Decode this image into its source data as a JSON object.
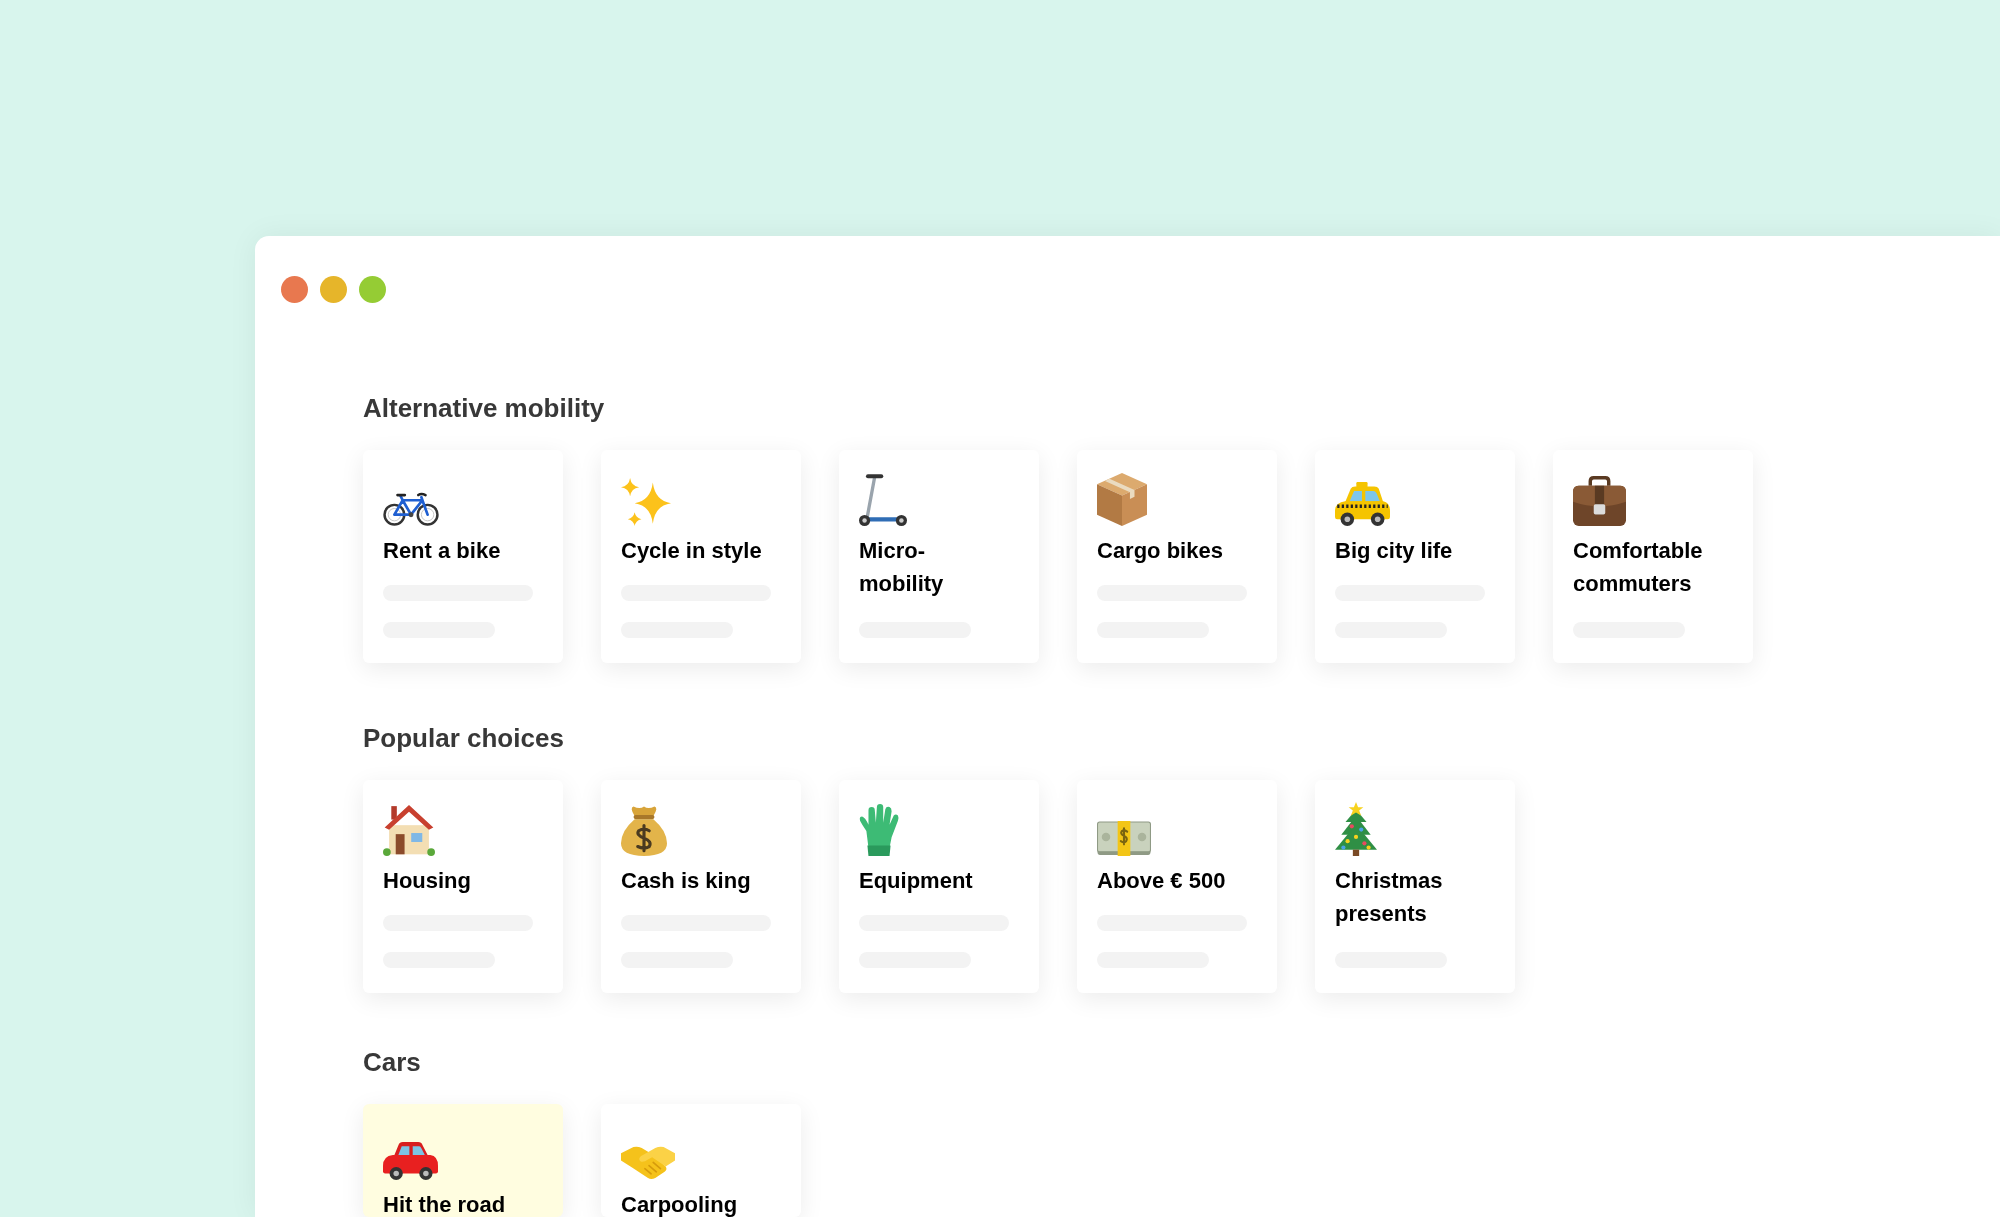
{
  "sections": [
    {
      "title": "Alternative mobility",
      "cards": [
        {
          "title": "Rent a bike",
          "selected": false
        },
        {
          "title": "Cycle in style",
          "selected": false
        },
        {
          "title": "Micro-mobility",
          "selected": false
        },
        {
          "title": "Cargo bikes",
          "selected": false
        },
        {
          "title": "Big city life",
          "selected": false
        },
        {
          "title": "Comfortable commuters",
          "selected": false
        }
      ]
    },
    {
      "title": "Popular choices",
      "cards": [
        {
          "title": "Housing",
          "selected": false
        },
        {
          "title": "Cash is king",
          "selected": false
        },
        {
          "title": "Equipment",
          "selected": false
        },
        {
          "title": "Above € 500",
          "selected": false
        },
        {
          "title": "Christmas presents",
          "selected": false
        }
      ]
    },
    {
      "title": "Cars",
      "cards": [
        {
          "title": "Hit the road",
          "selected": true
        },
        {
          "title": "Carpooling",
          "selected": false
        }
      ]
    }
  ]
}
